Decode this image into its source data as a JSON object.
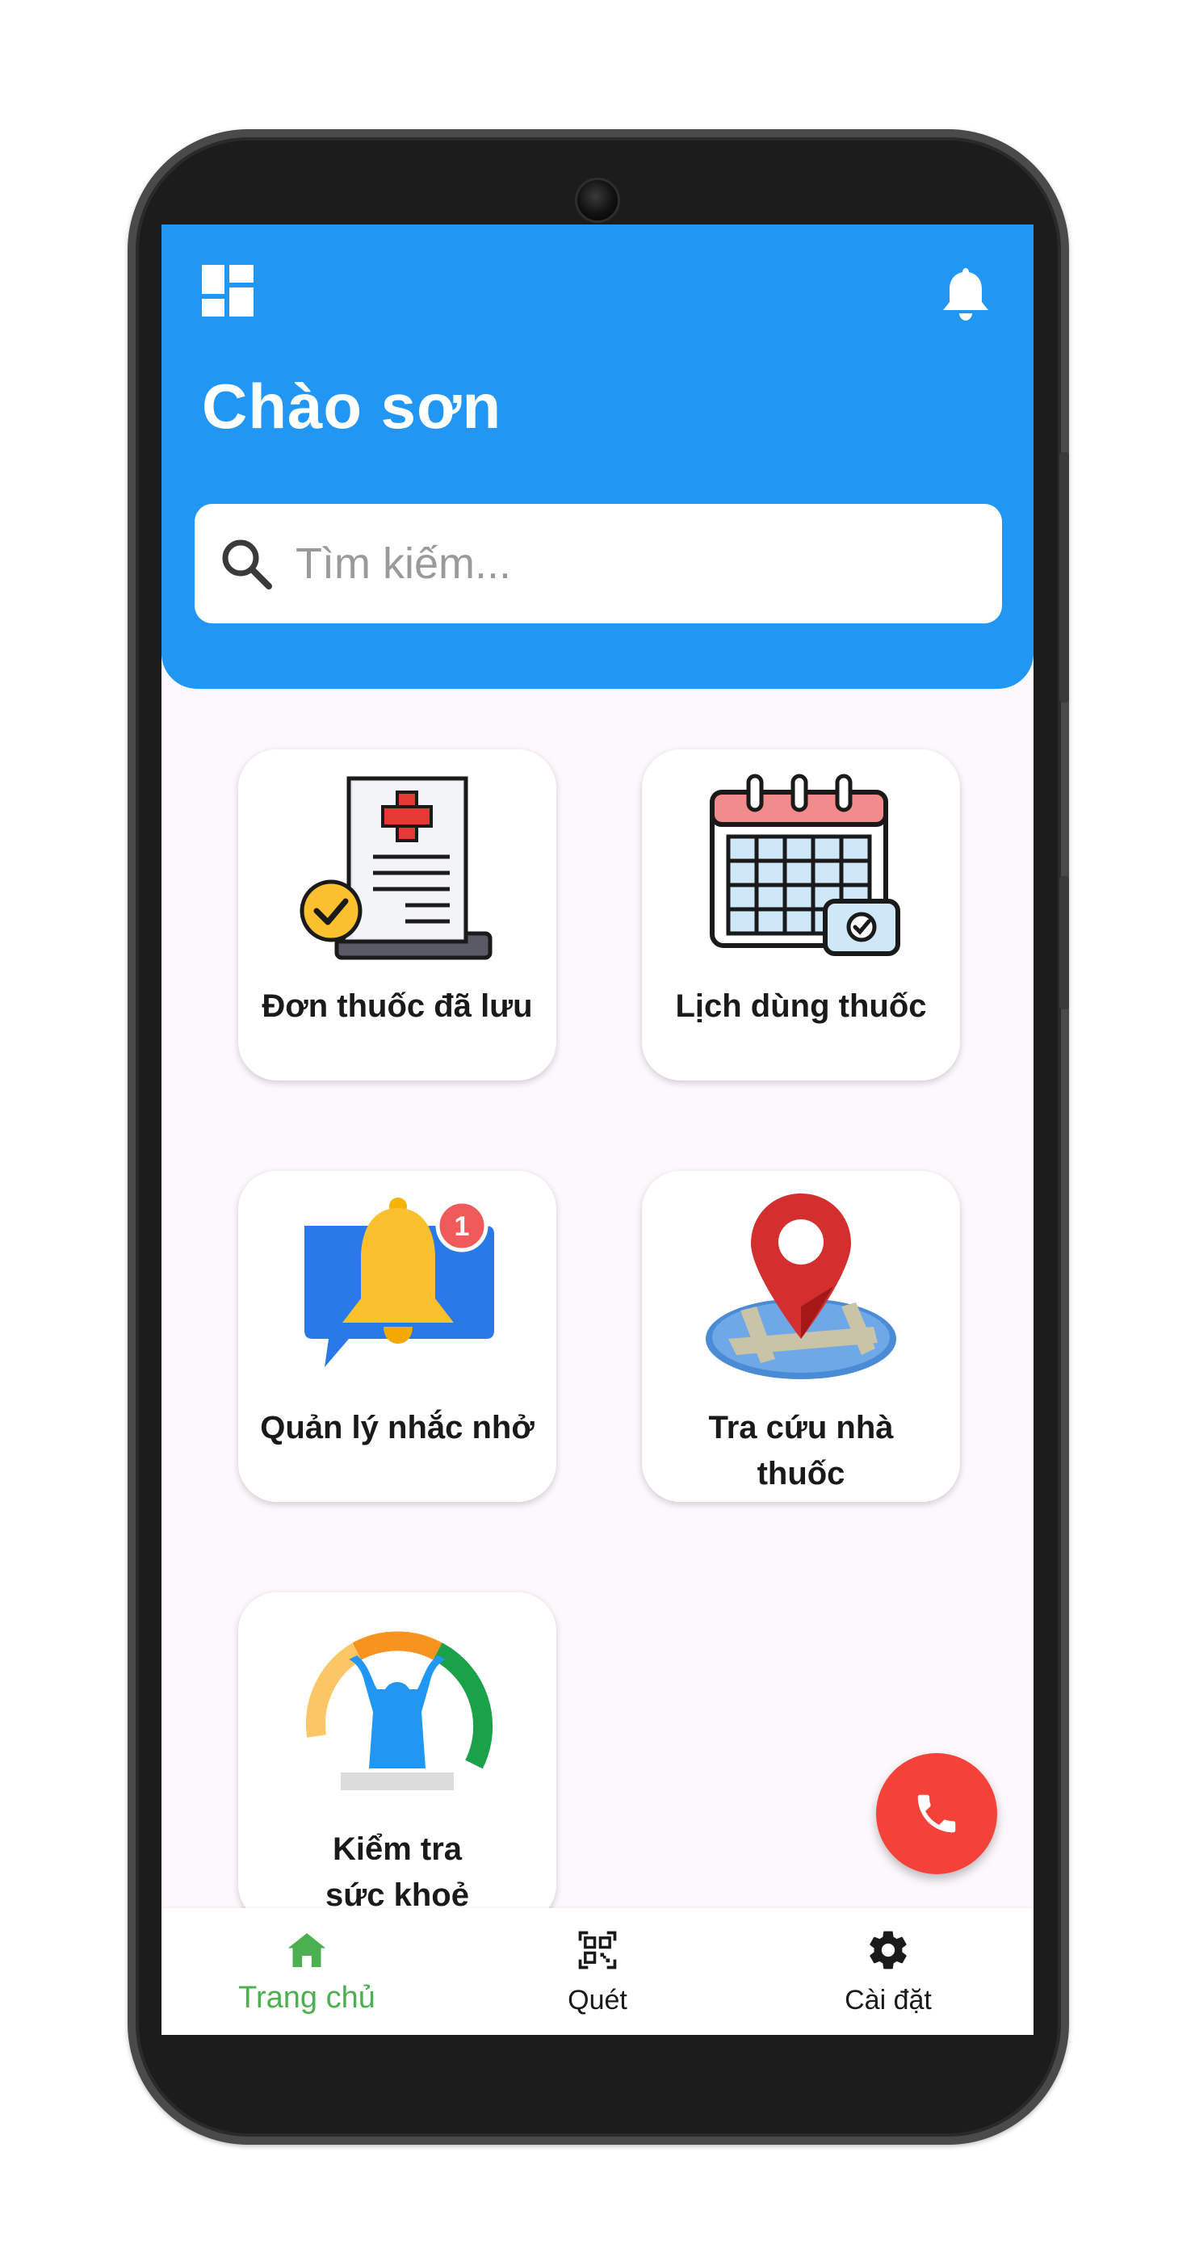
{
  "header": {
    "greeting": "Chào sơn"
  },
  "search": {
    "placeholder": "Tìm kiếm..."
  },
  "features": [
    {
      "label": "Đơn thuốc đã lưu",
      "icon": "saved-prescription-icon"
    },
    {
      "label": "Lịch dùng thuốc",
      "icon": "medication-calendar-icon"
    },
    {
      "label": "Quản lý nhắc nhở",
      "icon": "reminder-bell-icon"
    },
    {
      "label": "Tra cứu nhà thuốc",
      "icon": "pharmacy-map-pin-icon"
    },
    {
      "label": "Kiểm tra sức khoẻ",
      "icon": "health-check-icon"
    }
  ],
  "fab": {
    "icon": "phone-icon",
    "color": "#f4413a"
  },
  "bottom_nav": {
    "items": [
      {
        "label": "Trang chủ",
        "icon": "home-icon",
        "active": true
      },
      {
        "label": "Quét",
        "icon": "qr-scan-icon",
        "active": false
      },
      {
        "label": "Cài đặt",
        "icon": "gear-icon",
        "active": false
      }
    ]
  },
  "colors": {
    "primary": "#2196f3",
    "active_nav": "#4caf50",
    "fab": "#f4413a",
    "background": "#fcf8fc"
  }
}
